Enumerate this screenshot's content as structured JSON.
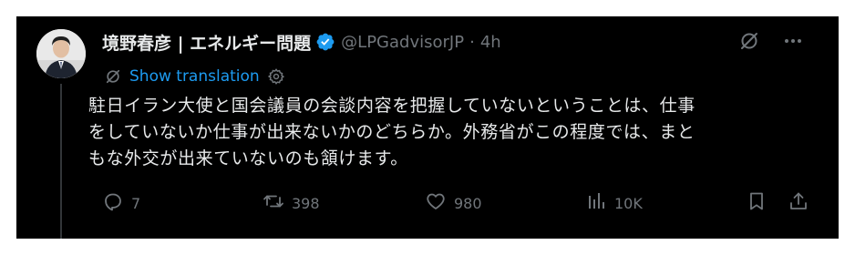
{
  "tweet": {
    "author_name": "境野春彦 | エネルギー問題",
    "handle": "@LPGadvisorJP",
    "separator": "·",
    "time": "4h",
    "translation_label": "Show translation",
    "text": "駐日イラン大使と国会議員の会談内容を把握していないということは、仕事\nをしていないか仕事が出来ないかのどちらか。外務省がこの程度では、まと\nもな外交が出来ていないのも頷けます。",
    "icons": {
      "verified": "verified-badge-icon",
      "grok": "grok-icon",
      "more": "more-icon",
      "translate": "translate-icon",
      "settings": "gear-icon"
    }
  },
  "actions": {
    "replies": "7",
    "reposts": "398",
    "likes": "980",
    "views": "10K"
  },
  "colors": {
    "background": "#000000",
    "text": "#e7e9ea",
    "muted": "#71767b",
    "accent": "#1d9bf0"
  }
}
